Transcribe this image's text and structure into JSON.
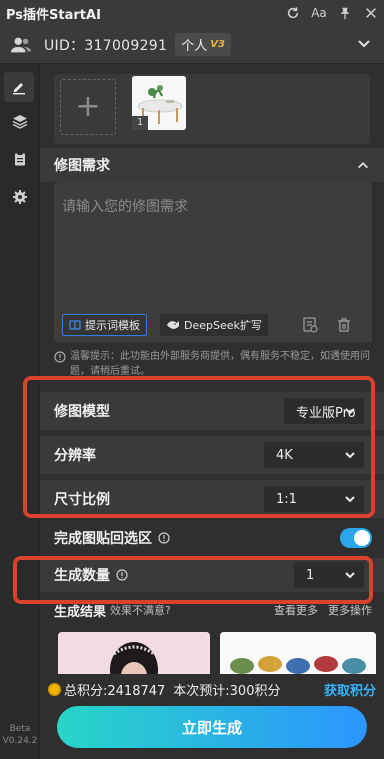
{
  "app": {
    "title": "Ps插件StartAI"
  },
  "titlebar_icons": [
    "refresh-icon",
    "font-size-icon",
    "pin-icon",
    "close-icon"
  ],
  "titlebar": {
    "font_label": "Aa"
  },
  "user": {
    "uid_label": "UID：317009291",
    "plan": "个人",
    "plan_version": "V3"
  },
  "rail": {
    "items": [
      "edit-icon",
      "layers-icon",
      "clipboard-icon",
      "settings-icon"
    ],
    "beta": "Beta",
    "version": "V0.24.2"
  },
  "upload": {
    "add_symbol": "+",
    "thumb_index": "1"
  },
  "request": {
    "header": "修图需求",
    "placeholder": "请输入您的修图需求",
    "template_label": "提示词模板",
    "deepseek_label": "DeepSeek扩写",
    "tip": "温馨提示：此功能由外部服务商提供，偶有服务不稳定，如遇使用问题，请稍后重试。"
  },
  "settings": {
    "model": {
      "label": "修图模型",
      "value": "专业版Pro"
    },
    "resolution": {
      "label": "分辨率",
      "value": "4K"
    },
    "ratio": {
      "label": "尺寸比例",
      "value": "1:1"
    },
    "paste_back": {
      "label": "完成图贴回选区",
      "enabled": true
    },
    "count": {
      "label": "生成数量",
      "value": "1"
    }
  },
  "results": {
    "label": "生成结果",
    "unsatisfied": "效果不满意?",
    "see_more": "查看更多",
    "more_ops": "更多操作"
  },
  "footer": {
    "total_points": "总积分:2418747",
    "estimate": "本次预计:300积分",
    "get_points": "获取积分",
    "generate": "立即生成"
  },
  "colors": {
    "accent_blue": "#2aa6ea",
    "annotation_red": "#d9422f",
    "gradient_start": "#28d6c7",
    "gradient_end": "#2b95ff",
    "coin": "#f2b705"
  }
}
